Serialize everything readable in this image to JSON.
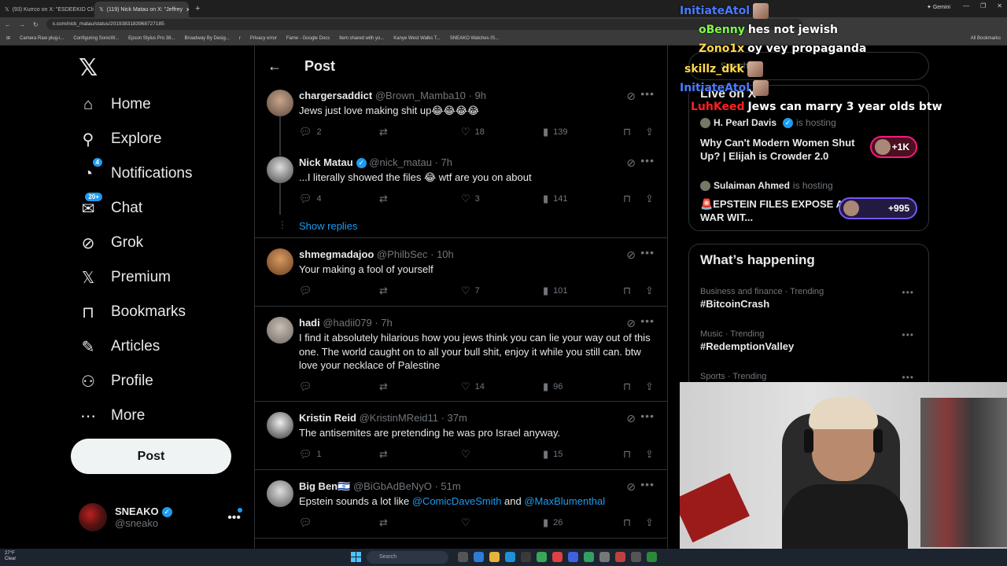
{
  "browser": {
    "tabs": [
      {
        "label": "(93) Kurrco on X: \"ESDEEKID Cli",
        "active": false
      },
      {
        "label": "(119) Nick Matau on X: \"Jeffrey",
        "active": true
      }
    ],
    "url": "x.com/nick_matau/status/2019383183968727185",
    "gemini_label": "Gemini",
    "bookmarks": [
      "Camera Raw plug-i...",
      "Configuring SonicW...",
      "Epson Stylus Pro 38...",
      "Broadway By Desig...",
      "r",
      "Privacy error",
      "Fame - Google Docs",
      "Item shared with yo...",
      "Kanye West Walks T...",
      "SNEAKO Watches IS..."
    ],
    "all_bookmarks": "All Bookmarks"
  },
  "nav": {
    "items": [
      {
        "label": "Home",
        "icon": "home-icon",
        "glyph": "⌂"
      },
      {
        "label": "Explore",
        "icon": "search-icon",
        "glyph": "⚲"
      },
      {
        "label": "Notifications",
        "icon": "bell-icon",
        "glyph": "🔔",
        "badge": "4"
      },
      {
        "label": "Chat",
        "icon": "mail-icon",
        "glyph": "✉",
        "badge": "20+"
      },
      {
        "label": "Grok",
        "icon": "grok-icon",
        "glyph": "⊘"
      },
      {
        "label": "Premium",
        "icon": "x-premium-icon",
        "glyph": "𝕏"
      },
      {
        "label": "Bookmarks",
        "icon": "bookmark-icon",
        "glyph": "🔖"
      },
      {
        "label": "Articles",
        "icon": "articles-icon",
        "glyph": "✎"
      },
      {
        "label": "Profile",
        "icon": "profile-icon",
        "glyph": "👤"
      },
      {
        "label": "More",
        "icon": "more-icon",
        "glyph": "⋯"
      }
    ],
    "post_button": "Post",
    "account": {
      "name": "SNEAKO",
      "handle": "@sneako"
    }
  },
  "main": {
    "title": "Post",
    "show_replies": "Show replies",
    "tweets": [
      {
        "name": "chargersaddict",
        "handle": "@Brown_Mamba10",
        "time": "· 9h",
        "text": "Jews just love making shit up😂😂😂😂",
        "replies": "2",
        "retweets": "",
        "likes": "18",
        "views": "139"
      },
      {
        "name": "Nick Matau",
        "handle": "@nick_matau",
        "time": "· 7h",
        "text": "...I literally showed the files 😂 wtf are you on about",
        "replies": "4",
        "retweets": "",
        "likes": "3",
        "views": "141"
      },
      {
        "name": "shmegmadajoo",
        "handle": "@PhilbSec",
        "time": "· 10h",
        "text": "Your making a fool of yourself",
        "replies": "",
        "retweets": "",
        "likes": "7",
        "views": "101"
      },
      {
        "name": "hadi",
        "handle": "@hadii079",
        "time": "· 7h",
        "text": "I find it absolutely hilarious how you jews think you can lie your way out of this one. The world caught on to all your bull shit, enjoy it while you still can. btw love your necklace of Palestine",
        "replies": "",
        "retweets": "",
        "likes": "14",
        "views": "96"
      },
      {
        "name": "Kristin Reid",
        "handle": "@KristinMReid11",
        "time": "· 37m",
        "text": "The antisemites are pretending he was pro Israel anyway.",
        "replies": "1",
        "retweets": "",
        "likes": "",
        "views": "15"
      },
      {
        "name": "Big Ben🇮🇱",
        "handle": "@BiGbAdBeNyO",
        "time": "· 51m",
        "text_prefix": "Epstein sounds a lot like ",
        "mention1": "@ComicDaveSmith",
        "text_mid": " and ",
        "mention2": "@MaxBlumenthal",
        "replies": "",
        "retweets": "",
        "likes": "",
        "views": "26"
      }
    ]
  },
  "right": {
    "search_placeholder": "Search",
    "live_title": "Live on X",
    "spaces": [
      {
        "host": "H. Pearl Davis",
        "hosting": "is hosting",
        "title": "Why Can't Modern Women Shut Up? | Elijah is Crowder 2.0",
        "count": "+1K"
      },
      {
        "host": "Sulaiman Ahmed",
        "hosting": "is hosting",
        "title": "🚨EPSTEIN FILES EXPOSE ALL | WAR WIT...",
        "count": "+995"
      }
    ],
    "happening_title": "What’s happening",
    "trends": [
      {
        "category": "Business and finance · Trending",
        "tag": "#BitcoinCrash"
      },
      {
        "category": "Music · Trending",
        "tag": "#RedemptionValley"
      },
      {
        "category": "Sports · Trending",
        "tag": ""
      }
    ]
  },
  "chat": [
    {
      "user": "InitiateAtol",
      "msg": "",
      "color": "#4a7bff"
    },
    {
      "user": "oBenny",
      "msg": "hes not jewish",
      "color": "#7cff4a"
    },
    {
      "user": "Zono1x",
      "msg": "oy vey propaganda",
      "color": "#ffd84a"
    },
    {
      "user": "skillz_dkk",
      "msg": "",
      "color": "#ffd84a"
    },
    {
      "user": "InitiateAtol",
      "msg": "",
      "color": "#4a7bff"
    },
    {
      "user": "LuhKeed",
      "msg": "Jews can marry 3 year olds btw",
      "color": "#ff2020"
    }
  ],
  "taskbar": {
    "weather_temp": "27°F",
    "weather_desc": "Clear",
    "search": "Search"
  }
}
